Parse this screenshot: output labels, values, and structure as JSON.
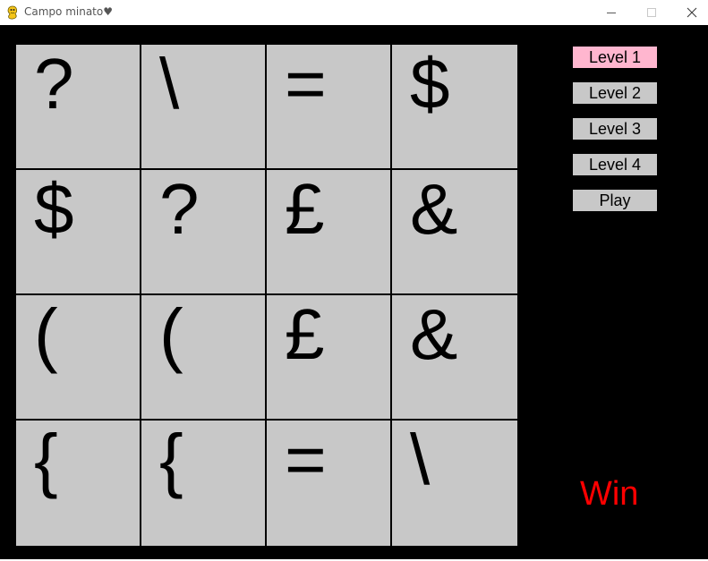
{
  "window": {
    "title": "Campo minato♥"
  },
  "icons": {
    "app": "pygame-snake-icon",
    "minimize": "minimize-icon",
    "maximize": "maximize-icon",
    "close": "close-icon"
  },
  "colors": {
    "background": "#000000",
    "cell": "#c8c8c8",
    "active_button": "#ffb6cf",
    "button": "#c8c8c8",
    "status": "#ff0000"
  },
  "board": {
    "rows": [
      [
        "?",
        "\\",
        "=",
        "$"
      ],
      [
        "$",
        "?",
        "£",
        "&"
      ],
      [
        "(",
        "(",
        "£",
        "&"
      ],
      [
        "{",
        "{",
        "=",
        "\\"
      ]
    ]
  },
  "menu": {
    "items": [
      {
        "label": "Level 1",
        "active": true
      },
      {
        "label": "Level 2",
        "active": false
      },
      {
        "label": "Level 3",
        "active": false
      },
      {
        "label": "Level 4",
        "active": false
      },
      {
        "label": "Play",
        "active": false
      }
    ]
  },
  "status": {
    "text": "Win"
  }
}
